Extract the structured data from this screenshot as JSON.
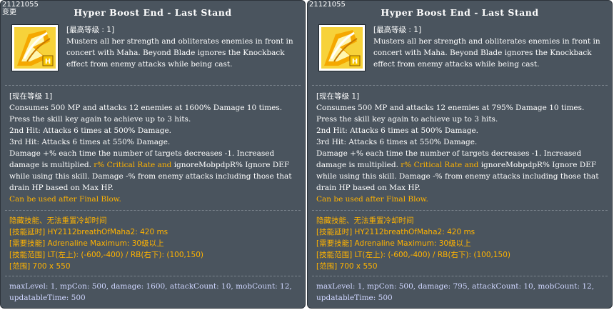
{
  "panels": [
    {
      "id": "21121055",
      "tag": "变更",
      "title": "Hyper Boost End - Last Stand",
      "max_level": "[最高等级 : 1]",
      "description": "Musters all her strength and obliterates enemies in front in concert with Maha. Beyond Blade ignores the Knockback effect from enemy attacks while being cast.",
      "current_level": "[现在等级 1]",
      "details": [
        "Consumes 500 MP and attacks 12 enemies at 1600% Damage 10 times.",
        "Press the skill key again to achieve up to 3 hits.",
        "2nd Hit: Attacks 6 times at 500% Damage.",
        "3rd Hit: Attacks 6 times at 550% Damage."
      ],
      "detail_extra_pre": "Damage +% each time the number of targets decreases -1. Increased damage is multiplied. ",
      "detail_extra_highlight": "r% Critical Rate and ",
      "detail_extra_post": "ignoreMobpdpR% Ignore DEF while using this skill. Damage -% from enemy attacks including those that drain HP based on Max HP.",
      "usage_note": "Can be used after Final Blow.",
      "hidden_info": [
        "隐藏技能、无法重置冷却时间",
        "[技能延时] HY2112breathOfMaha2: 420 ms",
        "[需要技能] Adrenaline Maximum: 30级以上",
        "[技能范围] LT(左上): (-600,-400) / RB(右下): (100,150)",
        "[范围] 700 x 550"
      ],
      "raw_data": "maxLevel: 1, mpCon: 500, damage: 1600, attackCount: 10, mobCount: 12, updatableTime: 500"
    },
    {
      "id": "21121055",
      "tag": "",
      "title": "Hyper Boost End - Last Stand",
      "max_level": "[最高等级 : 1]",
      "description": "Musters all her strength and obliterates enemies in front in concert with Maha. Beyond Blade ignores the Knockback effect from enemy attacks while being cast.",
      "current_level": "[现在等级 1]",
      "details": [
        "Consumes 500 MP and attacks 12 enemies at 795% Damage 10 times.",
        "Press the skill key again to achieve up to 3 hits.",
        "2nd Hit: Attacks 6 times at 500% Damage.",
        "3rd Hit: Attacks 6 times at 550% Damage."
      ],
      "detail_extra_pre": "Damage +% each time the number of targets decreases -1. Increased damage is multiplied. ",
      "detail_extra_highlight": "r% Critical Rate and ",
      "detail_extra_post": "ignoreMobpdpR% Ignore DEF while using this skill. Damage -% from enemy attacks including those that drain HP based on Max HP.",
      "usage_note": "Can be used after Final Blow.",
      "hidden_info": [
        "隐藏技能、无法重置冷却时间",
        "[技能延时] HY2112breathOfMaha2: 420 ms",
        "[需要技能] Adrenaline Maximum: 30级以上",
        "[技能范围] LT(左上): (-600,-400) / RB(右下): (100,150)",
        "[范围] 700 x 550"
      ],
      "raw_data": "maxLevel: 1, mpCon: 500, damage: 795, attackCount: 10, mobCount: 12, updatableTime: 500"
    }
  ],
  "icon": {
    "name": "skill-icon",
    "gold": "#f5c400",
    "dark_gold": "#c77a00",
    "white": "#ffffff"
  },
  "colors": {
    "panel_bg": "#4a545e",
    "text": "#ffffff",
    "highlight": "#ffb300",
    "stats": "#cfd6ff"
  }
}
